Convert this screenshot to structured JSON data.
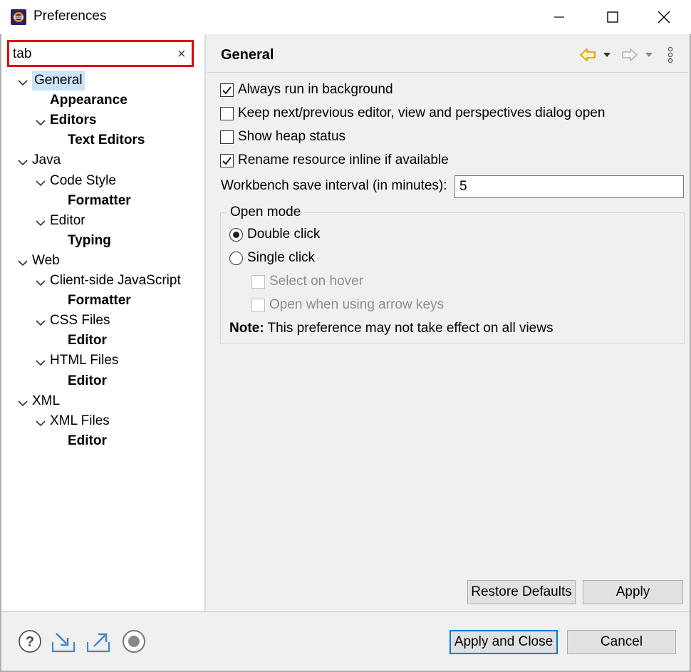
{
  "window": {
    "title": "Preferences",
    "controls": [
      "minimize-icon",
      "maximize-icon",
      "close-icon"
    ]
  },
  "search": {
    "value": "tab",
    "clear_glyph": "×"
  },
  "tree": {
    "items": [
      {
        "label": "General",
        "level": 0,
        "expanded": true,
        "bold": false,
        "selected": true
      },
      {
        "label": "Appearance",
        "level": 1,
        "expanded": null,
        "bold": true
      },
      {
        "label": "Editors",
        "level": 1,
        "expanded": true,
        "bold": true
      },
      {
        "label": "Text Editors",
        "level": 2,
        "expanded": null,
        "bold": true
      },
      {
        "label": "Java",
        "level": 0,
        "expanded": true,
        "bold": false
      },
      {
        "label": "Code Style",
        "level": 1,
        "expanded": true,
        "bold": false
      },
      {
        "label": "Formatter",
        "level": 2,
        "expanded": null,
        "bold": true
      },
      {
        "label": "Editor",
        "level": 1,
        "expanded": true,
        "bold": false
      },
      {
        "label": "Typing",
        "level": 2,
        "expanded": null,
        "bold": true
      },
      {
        "label": "Web",
        "level": 0,
        "expanded": true,
        "bold": false
      },
      {
        "label": "Client-side JavaScript",
        "level": 1,
        "expanded": true,
        "bold": false
      },
      {
        "label": "Formatter",
        "level": 2,
        "expanded": null,
        "bold": true
      },
      {
        "label": "CSS Files",
        "level": 1,
        "expanded": true,
        "bold": false
      },
      {
        "label": "Editor",
        "level": 2,
        "expanded": null,
        "bold": true
      },
      {
        "label": "HTML Files",
        "level": 1,
        "expanded": true,
        "bold": false
      },
      {
        "label": "Editor",
        "level": 2,
        "expanded": null,
        "bold": true
      },
      {
        "label": "XML",
        "level": 0,
        "expanded": true,
        "bold": false
      },
      {
        "label": "XML Files",
        "level": 1,
        "expanded": true,
        "bold": false
      },
      {
        "label": "Editor",
        "level": 2,
        "expanded": null,
        "bold": true
      }
    ]
  },
  "page": {
    "title": "General",
    "nav_icons": [
      "back-arrow-icon",
      "back-dropdown-icon",
      "forward-arrow-icon",
      "forward-dropdown-icon",
      "view-menu-icon"
    ],
    "accent_color": "#e0a000",
    "options": [
      {
        "label": "Always run in background",
        "checked": true
      },
      {
        "label": "Keep next/previous editor, view and perspectives dialog open",
        "checked": false
      },
      {
        "label": "Show heap status",
        "checked": false
      },
      {
        "label": "Rename resource inline if available",
        "checked": true
      }
    ],
    "save_interval": {
      "label": "Workbench save interval (in minutes):",
      "value": "5"
    },
    "open_mode": {
      "group_label": "Open mode",
      "radios": [
        {
          "label": "Double click",
          "selected": true
        },
        {
          "label": "Single click",
          "selected": false
        }
      ],
      "sub_options": [
        {
          "label": "Select on hover",
          "checked": false,
          "enabled": false
        },
        {
          "label": "Open when using arrow keys",
          "checked": false,
          "enabled": false
        }
      ],
      "note_prefix": "Note:",
      "note_text": "This preference may not take effect on all views"
    },
    "restore_defaults_label": "Restore Defaults",
    "apply_label": "Apply"
  },
  "footer": {
    "icons": [
      "help-icon",
      "import-icon",
      "export-icon",
      "record-icon"
    ],
    "apply_close_label": "Apply and Close",
    "cancel_label": "Cancel"
  }
}
